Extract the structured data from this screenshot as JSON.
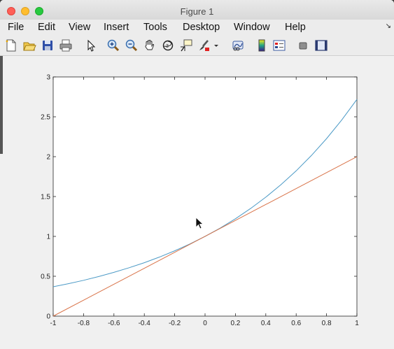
{
  "window": {
    "title": "Figure 1"
  },
  "menu": [
    "File",
    "Edit",
    "View",
    "Insert",
    "Tools",
    "Desktop",
    "Window",
    "Help"
  ],
  "toolbar": [
    "new-figure-icon",
    "open-file-icon",
    "save-icon",
    "print-icon",
    "pointer-icon",
    "zoom-in-icon",
    "zoom-out-icon",
    "pan-hand-icon",
    "rotate-3d-icon",
    "data-cursor-icon",
    "brush-icon",
    "brush-dropdown-icon",
    "link-plot-icon",
    "colorbar-icon",
    "legend-icon",
    "hide-plot-tools-icon",
    "show-plot-tools-icon"
  ],
  "chart_data": {
    "type": "line",
    "xlim": [
      -1,
      1
    ],
    "ylim": [
      0,
      3
    ],
    "xticks": [
      "-1",
      "-0.8",
      "-0.6",
      "-0.4",
      "-0.2",
      "0",
      "0.2",
      "0.4",
      "0.6",
      "0.8",
      "1"
    ],
    "yticks": [
      "0",
      "0.5",
      "1",
      "1.5",
      "2",
      "2.5",
      "3"
    ],
    "grid": false,
    "series": [
      {
        "color": "#4c9ac6",
        "x": [
          -1,
          -0.9,
          -0.8,
          -0.7,
          -0.6,
          -0.5,
          -0.4,
          -0.3,
          -0.2,
          -0.1,
          0,
          0.1,
          0.2,
          0.3,
          0.4,
          0.5,
          0.6,
          0.7,
          0.8,
          0.9,
          1
        ],
        "y": [
          0.368,
          0.407,
          0.449,
          0.497,
          0.549,
          0.607,
          0.67,
          0.741,
          0.819,
          0.905,
          1.0,
          1.105,
          1.221,
          1.35,
          1.492,
          1.649,
          1.822,
          2.014,
          2.226,
          2.46,
          2.718
        ]
      },
      {
        "color": "#d9744a",
        "x": [
          -1,
          1
        ],
        "y": [
          0,
          2
        ]
      }
    ]
  }
}
